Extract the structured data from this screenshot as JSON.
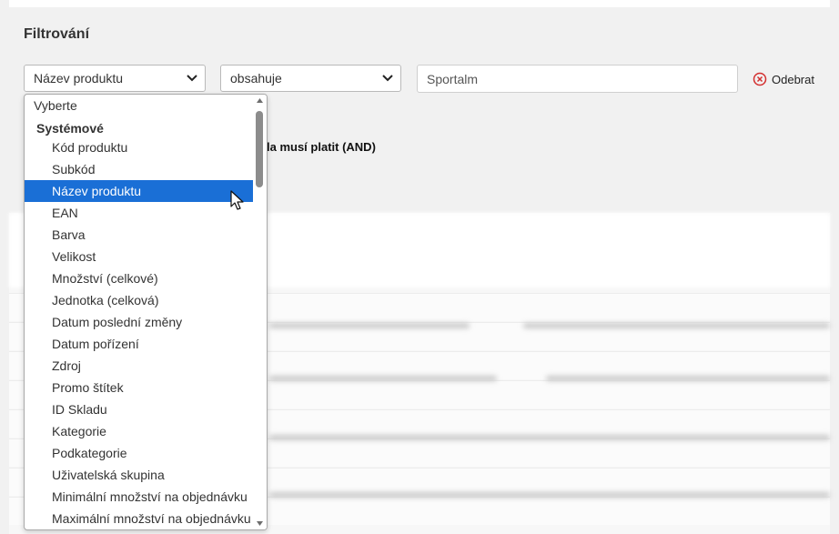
{
  "page": {
    "title": "Filtrování"
  },
  "filter": {
    "field_select": {
      "value": "Název produktu"
    },
    "operator_select": {
      "value": "obsahuje"
    },
    "value_input": {
      "value": "Sportalm"
    },
    "remove_label": "Odebrat",
    "condition_text": "la musí platit (AND)"
  },
  "dropdown": {
    "placeholder": "Vyberte",
    "group_label": "Systémové",
    "selected_index": 2,
    "items": [
      "Kód produktu",
      "Subkód",
      "Název produktu",
      "EAN",
      "Barva",
      "Velikost",
      "Množství (celkové)",
      "Jednotka (celková)",
      "Datum poslední změny",
      "Datum pořízení",
      "Zdroj",
      "Promo štítek",
      "ID Skladu",
      "Kategorie",
      "Podkategorie",
      "Uživatelská skupina",
      "Minimální množství na objednávku",
      "Maximální množství na objednávku"
    ]
  },
  "colors": {
    "selection": "#1a6fd6",
    "remove_icon": "#d32f2f",
    "accent_green": "#2e7d32"
  },
  "icons": {
    "remove": "circle-x-icon",
    "dropdown": "chevron-down-icon",
    "cursor": "mouse-pointer-icon"
  }
}
